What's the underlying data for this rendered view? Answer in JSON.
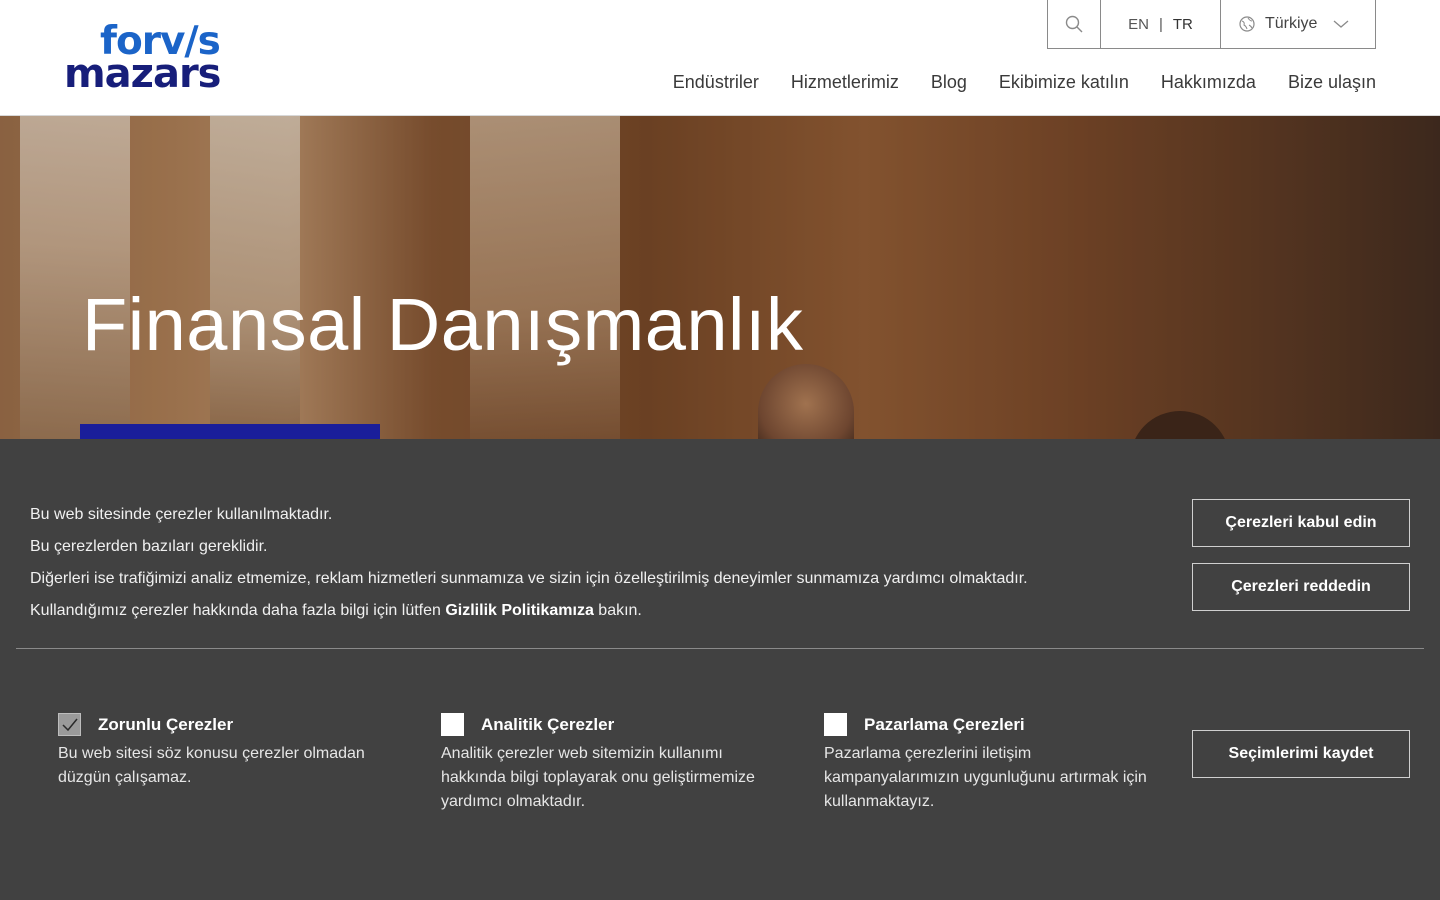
{
  "header": {
    "logo_line1": "forv/s",
    "logo_line2": "mazars",
    "lang_en": "EN",
    "lang_sep": "|",
    "lang_tr": "TR",
    "country": "Türkiye",
    "nav": [
      "Endüstriler",
      "Hizmetlerimiz",
      "Blog",
      "Ekibimize katılın",
      "Hakkımızda",
      "Bize ulaşın"
    ]
  },
  "hero": {
    "title": "Finansal Danışmanlık"
  },
  "cookie": {
    "line1": "Bu web sitesinde çerezler kullanılmaktadır.",
    "line2": "Bu çerezlerden bazıları gereklidir.",
    "line3": "Diğerleri ise trafiğimizi analiz etmemize, reklam hizmetleri sunmamıza ve sizin için özelleştirilmiş deneyimler sunmamıza yardımcı olmaktadır.",
    "line4_pre": "Kullandığımız çerezler hakkında daha fazla bilgi için lütfen ",
    "line4_link": "Gizlilik Politikamıza",
    "line4_post": " bakın.",
    "accept_label": "Çerezleri kabul edin",
    "reject_label": "Çerezleri reddedin",
    "save_label": "Seçimlerimi kaydet",
    "options": [
      {
        "title": "Zorunlu Çerezler",
        "desc": "Bu web sitesi söz konusu çerezler olmadan düzgün çalışamaz.",
        "checked": true
      },
      {
        "title": "Analitik Çerezler",
        "desc": "Analitik çerezler web sitemizin kullanımı hakkında bilgi toplayarak onu geliştirmemize yardımcı olmaktadır.",
        "checked": false
      },
      {
        "title": "Pazarlama Çerezleri",
        "desc": "Pazarlama çerezlerini iletişim kampanyalarımızın uygunluğunu artırmak için kullanmaktayız.",
        "checked": false
      }
    ]
  },
  "colors": {
    "brand_blue": "#1b64c8",
    "brand_navy": "#171e7a",
    "cookie_bg": "#414141",
    "cta_blue": "#1a1e9a"
  }
}
